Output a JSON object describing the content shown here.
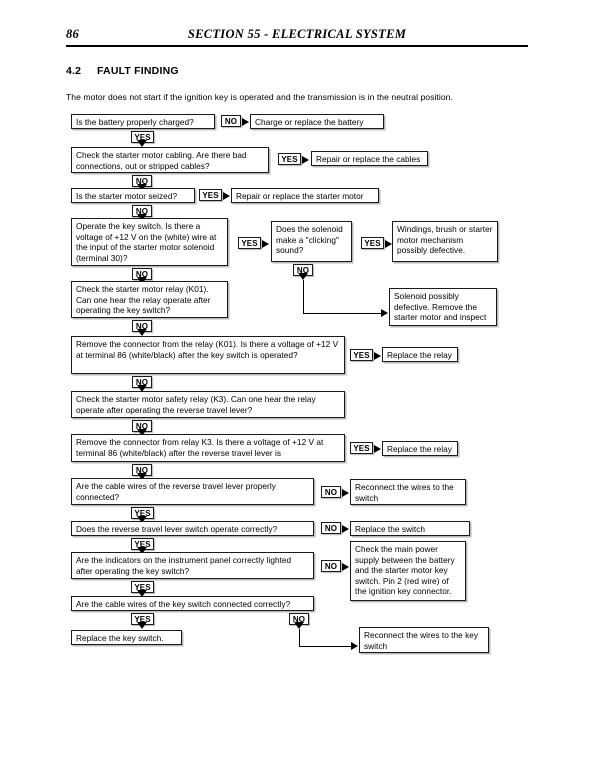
{
  "header": {
    "folio": "86",
    "section_title": "SECTION 55 - ELECTRICAL SYSTEM"
  },
  "heading": {
    "number": "4.2",
    "title": "FAULT FINDING"
  },
  "intro": "The motor does not start if the ignition key is operated and the transmission is in the neutral position.",
  "labels": {
    "yes": "YES",
    "no": "NO"
  },
  "flow": {
    "q_battery": "Is the battery properly charged?",
    "a_battery": "Charge or replace the battery",
    "q_cabling": "Check the starter motor cabling. Are there bad connections, out or stripped cables?",
    "a_cabling": "Repair or replace the cables",
    "q_seized": "Is the starter motor seized?",
    "a_seized": "Repair or replace the starter motor",
    "q_keyswitch_voltage": "Operate the key switch. Is there a voltage of +12 V on the (white) wire at the input of the starter motor solenoid (terminal 30)?",
    "q_solenoid_click": "Does the solenoid make a \"clicking\" sound?",
    "a_windings": "Windings, brush or starter motor mechanism possibly defective.",
    "a_solenoid_defective": "Solenoid possibly defective. Remove the starter motor and inspect",
    "q_relay_k01": "Check the starter motor relay (K01). Can one hear the relay operate after operating the key switch?",
    "q_relay_k01_voltage": "Remove the connector from the relay (K01). Is there a voltage of +12 V at terminal 86 (white/black) after the key switch is operated?",
    "a_replace_relay_1": "Replace the relay",
    "q_safety_relay_k3": "Check the starter motor safety relay (K3). Can one hear the relay operate after operating the reverse travel lever?",
    "q_relay_k3_voltage": "Remove the connector from relay K3. Is there a voltage of +12 V at terminal 86 (white/black) after the reverse travel lever is",
    "a_replace_relay_2": "Replace the relay",
    "q_cable_wires_lever": "Are the cable wires of the reverse travel lever properly connected?",
    "a_reconnect_switch": "Reconnect the wires to the switch",
    "q_lever_switch_operate": "Does the reverse travel lever switch operate correctly?",
    "a_replace_switch": "Replace the switch",
    "q_indicators": "Are the indicators on the instrument panel correctly lighted after operating the key switch?",
    "a_main_power": "Check the main power supply between the battery and the starter motor key switch. Pin 2 (red wire) of the ignition key connector.",
    "q_key_switch_wires": "Are the cable wires of the key switch connected correctly?",
    "a_replace_key_switch": "Replace the key switch.",
    "a_reconnect_key_switch": "Reconnect the wires to the key switch"
  }
}
